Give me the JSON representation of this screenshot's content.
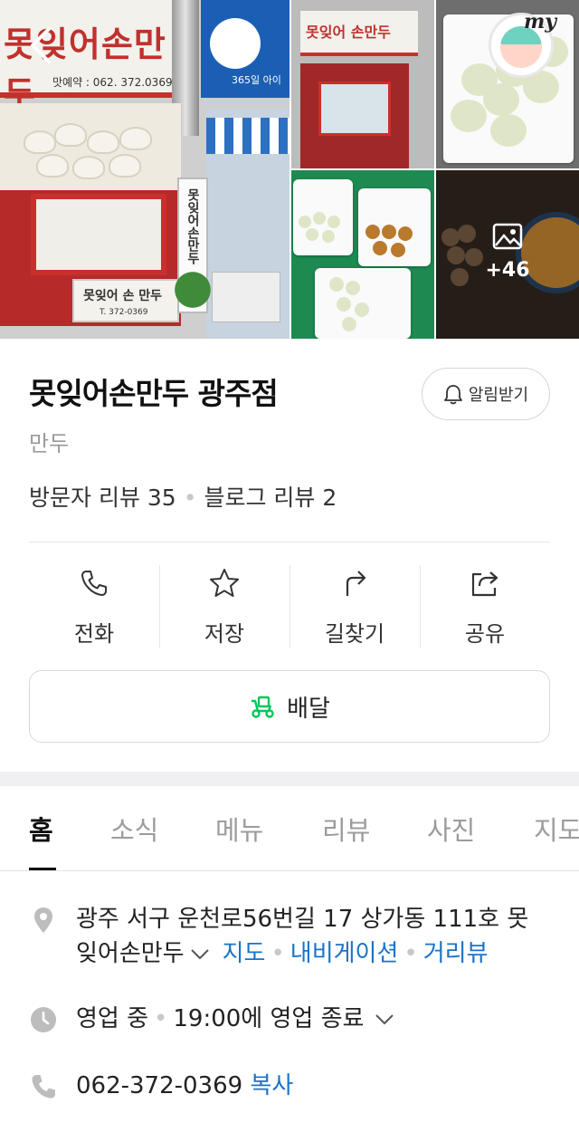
{
  "photos": {
    "main_sign": "못잊어손만두",
    "main_sign_phone": "맛예약 : 062. 372.0369",
    "blue_sign": "365일 아이",
    "low_sign": "못잊어 손 만두",
    "low_sign_phone": "T. 372-0369",
    "vertical_sign": "못잊어손만두",
    "photo2_sign": "못잊어 손만두",
    "more_count": "+46",
    "my_label": "my"
  },
  "place": {
    "name": "못잊어손만두 광주점",
    "category": "만두",
    "alarm_label": "알림받기",
    "visitor_reviews": "방문자 리뷰 35",
    "blog_reviews": "블로그 리뷰 2"
  },
  "actions": [
    {
      "label": "전화",
      "icon": "phone-icon"
    },
    {
      "label": "저장",
      "icon": "star-icon"
    },
    {
      "label": "길찾기",
      "icon": "directions-icon"
    },
    {
      "label": "공유",
      "icon": "share-icon"
    }
  ],
  "delivery": {
    "label": "배달",
    "icon": "delivery-scooter-icon",
    "accent": "#03c75a"
  },
  "tabs": [
    "홈",
    "소식",
    "메뉴",
    "리뷰",
    "사진",
    "지도"
  ],
  "details": {
    "address_line1": "광주 서구 운천로56번길 17 상가동 111호 못",
    "address_line2": "잊어손만두",
    "map_link": "지도",
    "navigation_link": "내비게이션",
    "streetview_link": "거리뷰",
    "status": "영업 중",
    "hours": "19:00에 영업 종료",
    "phone": "062-372-0369",
    "copy_label": "복사"
  },
  "colors": {
    "link": "#1a73c9",
    "brand_green": "#03c75a",
    "text_muted": "#9a9a9a"
  }
}
